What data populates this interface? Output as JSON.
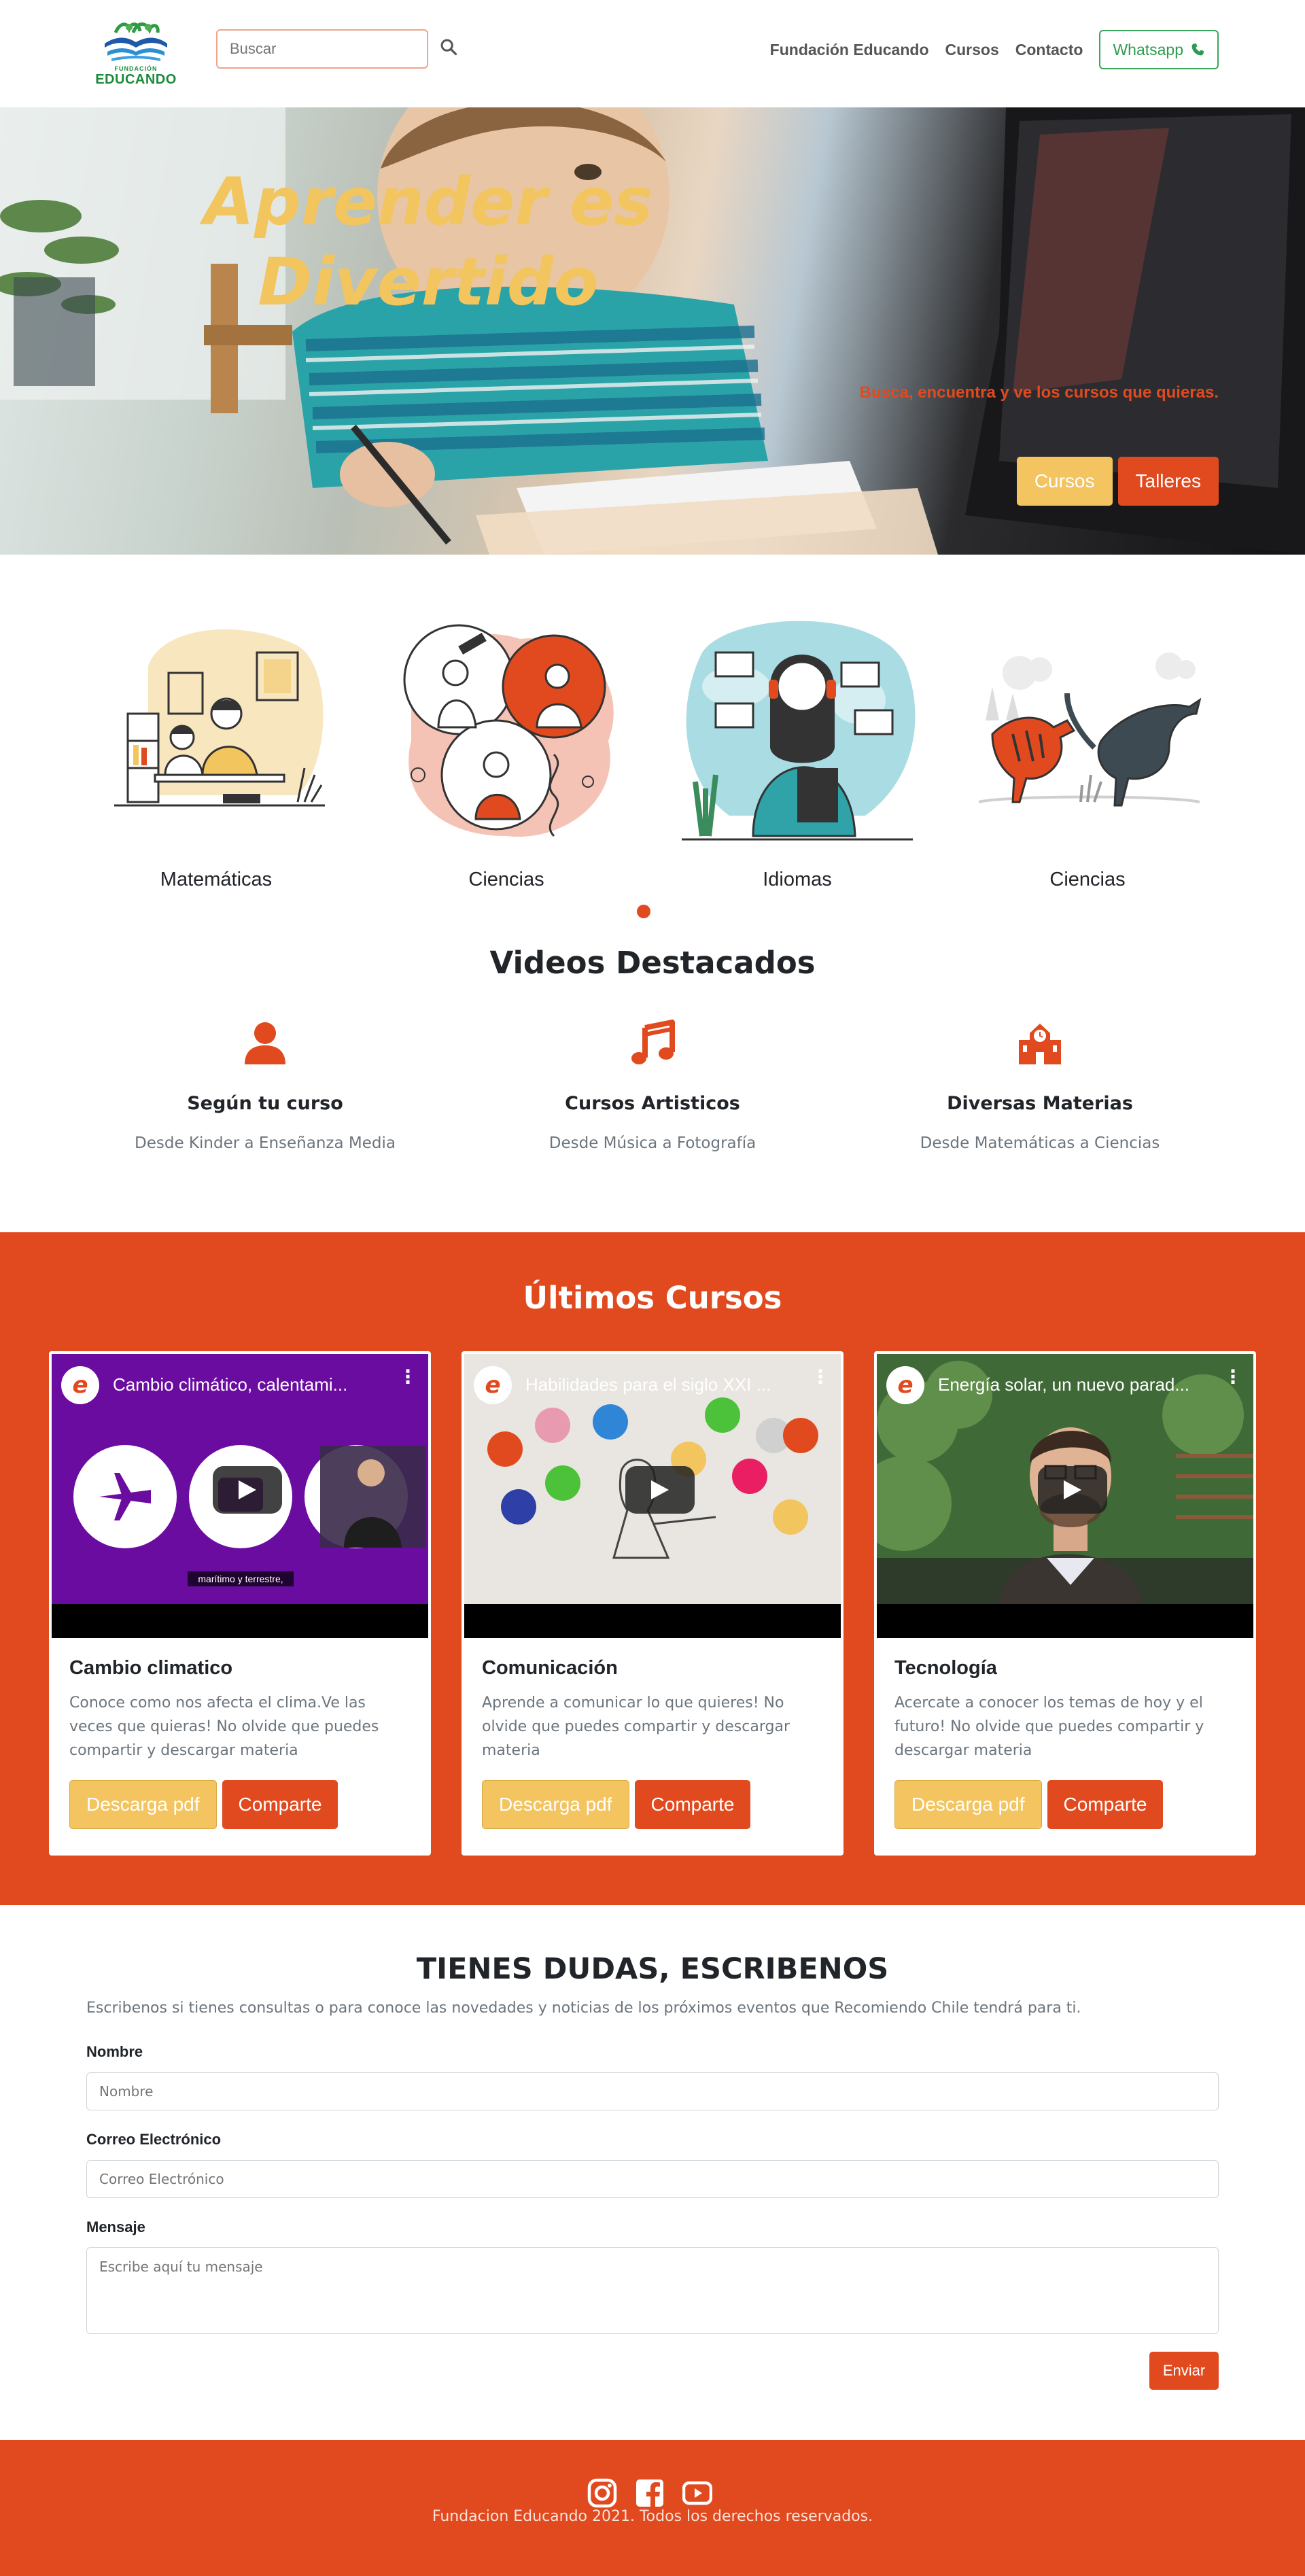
{
  "navbar": {
    "logo_sub": "FUNDACIÓN",
    "logo_main": "EDUCANDO",
    "search_placeholder": "Buscar",
    "links": [
      "Fundación Educando",
      "Cursos",
      "Contacto"
    ],
    "whatsapp_label": "Whatsapp",
    "icons": {
      "search": "search-icon",
      "whatsapp": "phone-icon"
    }
  },
  "hero": {
    "title": "Aprender es Divertido",
    "subtitle": "Busca, encuentra y ve los cursos que quieras.",
    "buttons": [
      "Cursos",
      "Talleres"
    ]
  },
  "categories": [
    {
      "label": "Matemáticas",
      "illustration": "father-and-child-studying"
    },
    {
      "label": "Ciencias",
      "illustration": "scientists-in-lab"
    },
    {
      "label": "Idiomas",
      "illustration": "woman-with-headset-languages"
    },
    {
      "label": "Ciencias",
      "illustration": "dinosaurs"
    }
  ],
  "featured": {
    "title": "Videos Destacados",
    "items": [
      {
        "icon": "user-icon",
        "title": "Según tu curso",
        "desc": "Desde Kinder a Enseñanza Media"
      },
      {
        "icon": "music-icon",
        "title": "Cursos Artisticos",
        "desc": "Desde Música a Fotografía"
      },
      {
        "icon": "school-icon",
        "title": "Diversas Materias",
        "desc": "Desde Matemáticas a Ciencias"
      }
    ]
  },
  "courses": {
    "title": "Últimos Cursos",
    "items": [
      {
        "video_title": "Cambio climático, calentami...",
        "video_caption": "marítimo y terrestre,",
        "title": "Cambio climatico",
        "text": "Conoce como nos afecta el clima.Ve las veces que quieras! No olvide que puedes compartir y descargar materia",
        "download_label": "Descarga pdf",
        "share_label": "Comparte"
      },
      {
        "video_title": "Habilidades para el siglo XXI ...",
        "video_caption": "",
        "title": "Comunicación",
        "text": "Aprende a comunicar lo que quieres! No olvide que puedes compartir y descargar materia",
        "download_label": "Descarga pdf",
        "share_label": "Comparte"
      },
      {
        "video_title": "Energía solar, un nuevo parad...",
        "video_caption": "",
        "title": "Tecnología",
        "text": "Acercate a conocer los temas de hoy y el futuro! No olvide que puedes compartir y descargar materia",
        "download_label": "Descarga pdf",
        "share_label": "Comparte"
      }
    ],
    "channel_avatar_letter": "e"
  },
  "contact": {
    "title": "TIENES DUDAS, ESCRIBENOS",
    "desc": "Escribenos si tienes consultas o para conoce las novedades y noticias de los próximos eventos que Recomiendo Chile tendrá para ti.",
    "name_label": "Nombre",
    "name_placeholder": "Nombre",
    "email_label": "Correo Electrónico",
    "email_placeholder": "Correo Electrónico",
    "message_label": "Mensaje",
    "message_placeholder": "Escribe aquí tu mensaje",
    "submit_label": "Enviar"
  },
  "footer": {
    "social": [
      "instagram-icon",
      "facebook-icon",
      "youtube-icon"
    ],
    "text": "Fundacion Educando 2021. Todos los derechos reservados."
  },
  "colors": {
    "brand_orange": "#e14a1f",
    "brand_yellow": "#f3c45f",
    "whatsapp_green": "#2f9a4f",
    "text_muted": "#6c757d"
  }
}
